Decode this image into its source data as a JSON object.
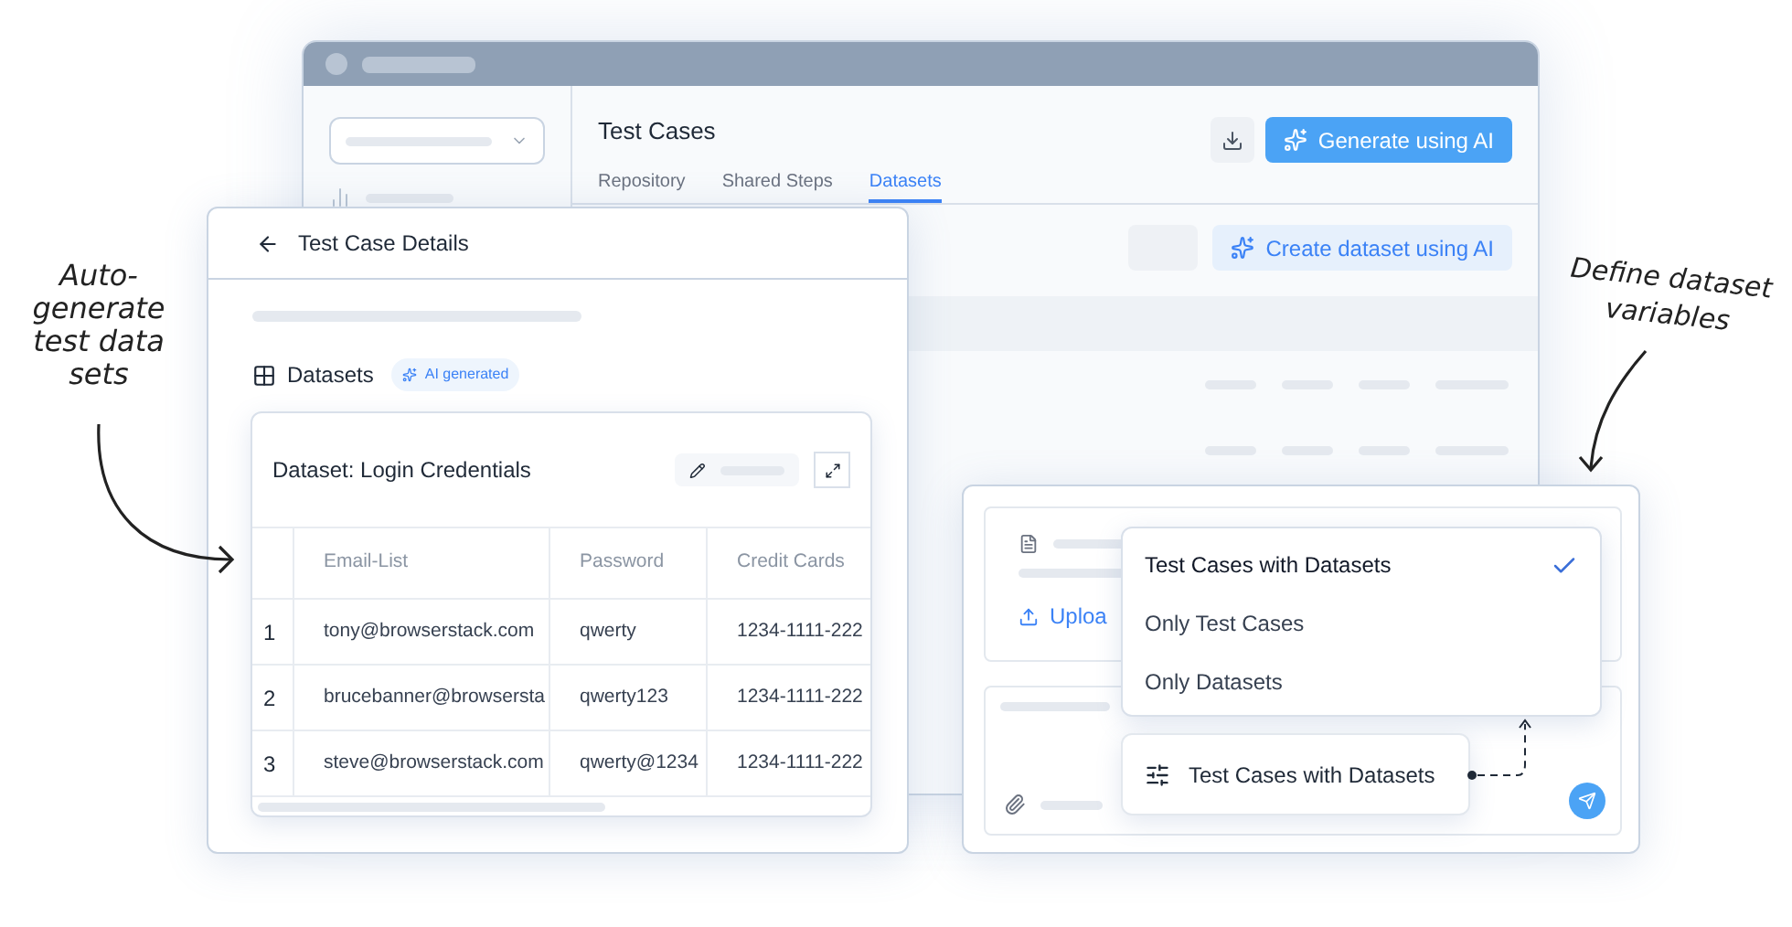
{
  "main_window": {
    "title": "Test Cases",
    "download_button": {
      "kind": "icon"
    },
    "generate_button": "Generate using AI",
    "tabs": [
      {
        "label": "Repository",
        "selected": false
      },
      {
        "label": "Shared Steps",
        "selected": false
      },
      {
        "label": "Datasets",
        "selected": true
      }
    ],
    "create_dataset_button": "Create dataset using AI"
  },
  "details_panel": {
    "title": "Test Case Details",
    "section_title": "Datasets",
    "ai_badge": "AI generated",
    "dataset": {
      "title": "Dataset: Login Credentials",
      "columns": [
        "",
        "Email-List",
        "Password",
        "Credit Cards"
      ],
      "rows": [
        [
          "1",
          "tony@browserstack.com",
          "qwerty",
          "1234-1111-222"
        ],
        [
          "2",
          "brucebanner@browsersta",
          "qwerty123",
          "1234-1111-222"
        ],
        [
          "3",
          "steve@browserstack.com",
          "qwerty@1234",
          "1234-1111-222"
        ]
      ]
    }
  },
  "import_panel": {
    "upload_label": "Uploa",
    "options": [
      {
        "label": "Test Cases with Datasets",
        "selected": true
      },
      {
        "label": "Only Test Cases",
        "selected": false
      },
      {
        "label": "Only Datasets",
        "selected": false
      }
    ],
    "selected_chip": "Test Cases with Datasets"
  },
  "annotations": [
    {
      "text": "Auto-\ngenerate\ntest data\nsets"
    },
    {
      "text": "Define dataset\nvariables"
    }
  ]
}
